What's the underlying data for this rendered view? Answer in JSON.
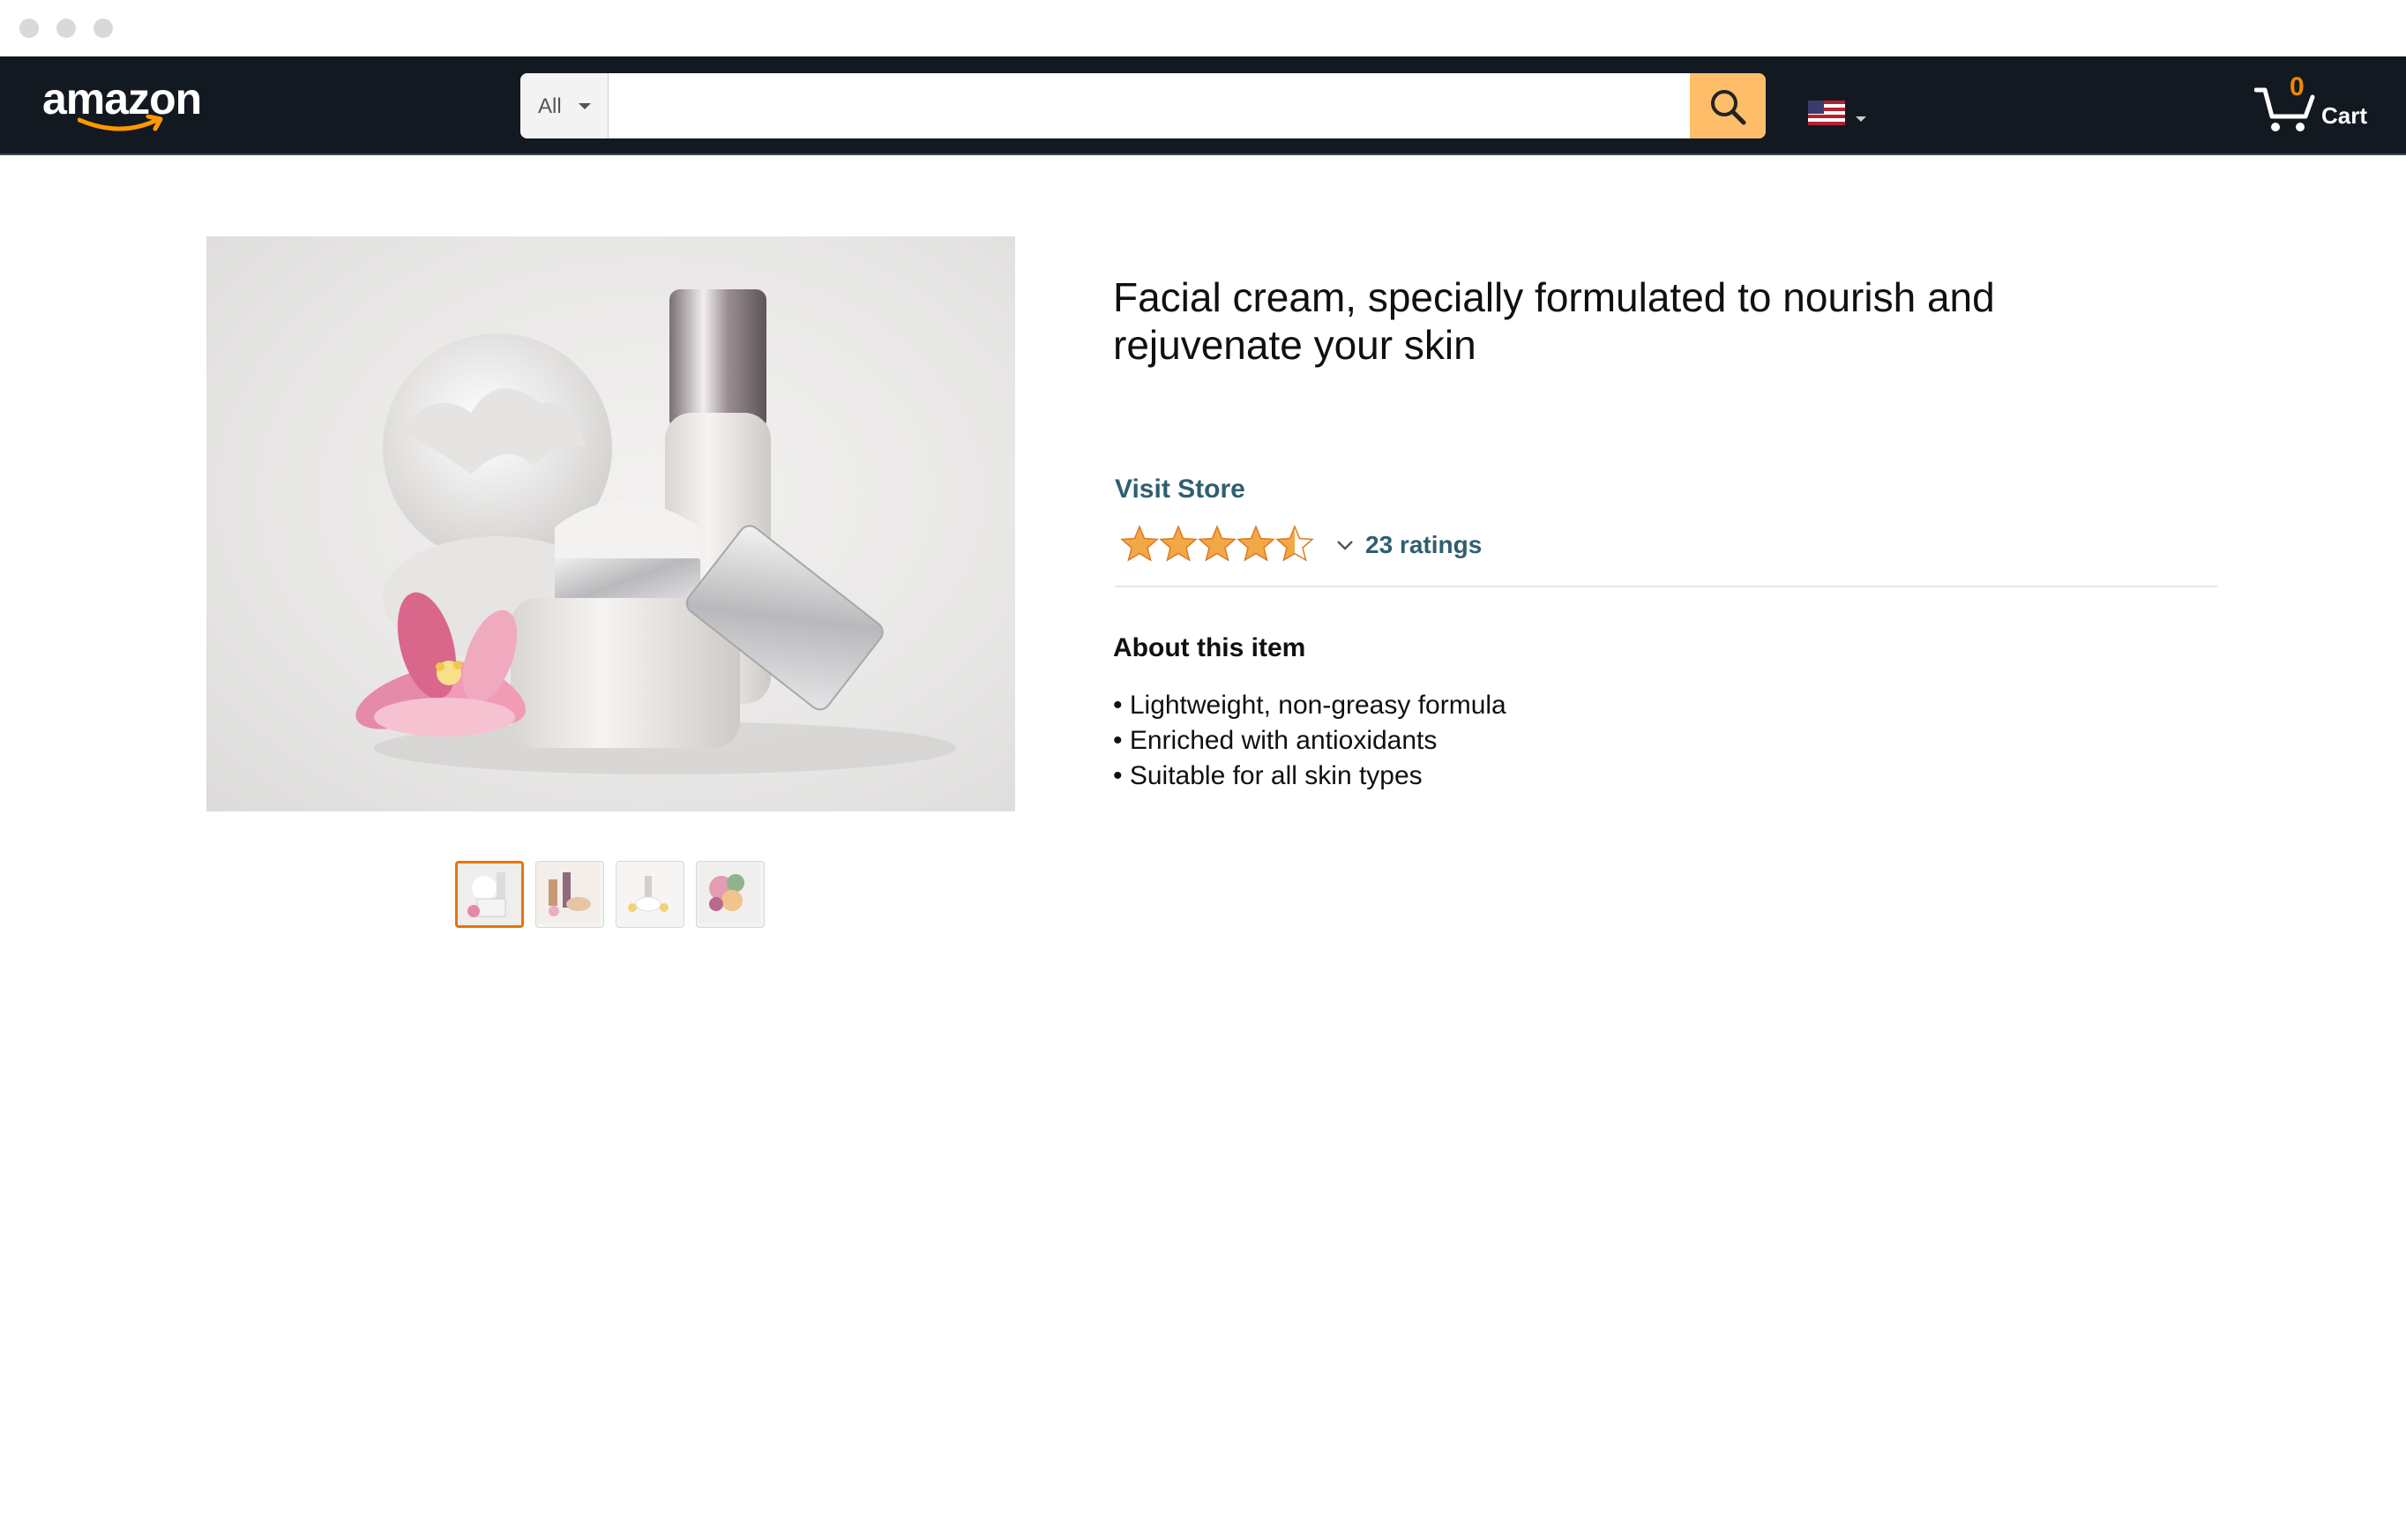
{
  "header": {
    "logo_text": "amazon",
    "search": {
      "category": "All",
      "placeholder": "",
      "value": ""
    },
    "cart": {
      "count": "0",
      "label": "Cart"
    },
    "locale_flag": "us-flag-icon"
  },
  "product": {
    "title": "Facial cream, specially formulated to nourish and rejuvenate your skin",
    "store_link": "Visit Store",
    "rating": 4.5,
    "ratings_text": "23 ratings",
    "about_heading": "About this item",
    "bullets": [
      "• Lightweight, non-greasy formula",
      "• Enriched with antioxidants",
      "• Suitable for all skin types"
    ],
    "thumbnail_count": 4,
    "selected_thumbnail": 1
  },
  "colors": {
    "nav_bg": "#131921",
    "search_button": "#febd69",
    "star": "#f3a847",
    "link": "#2f5f6f",
    "thumb_active_border": "#e77600"
  }
}
